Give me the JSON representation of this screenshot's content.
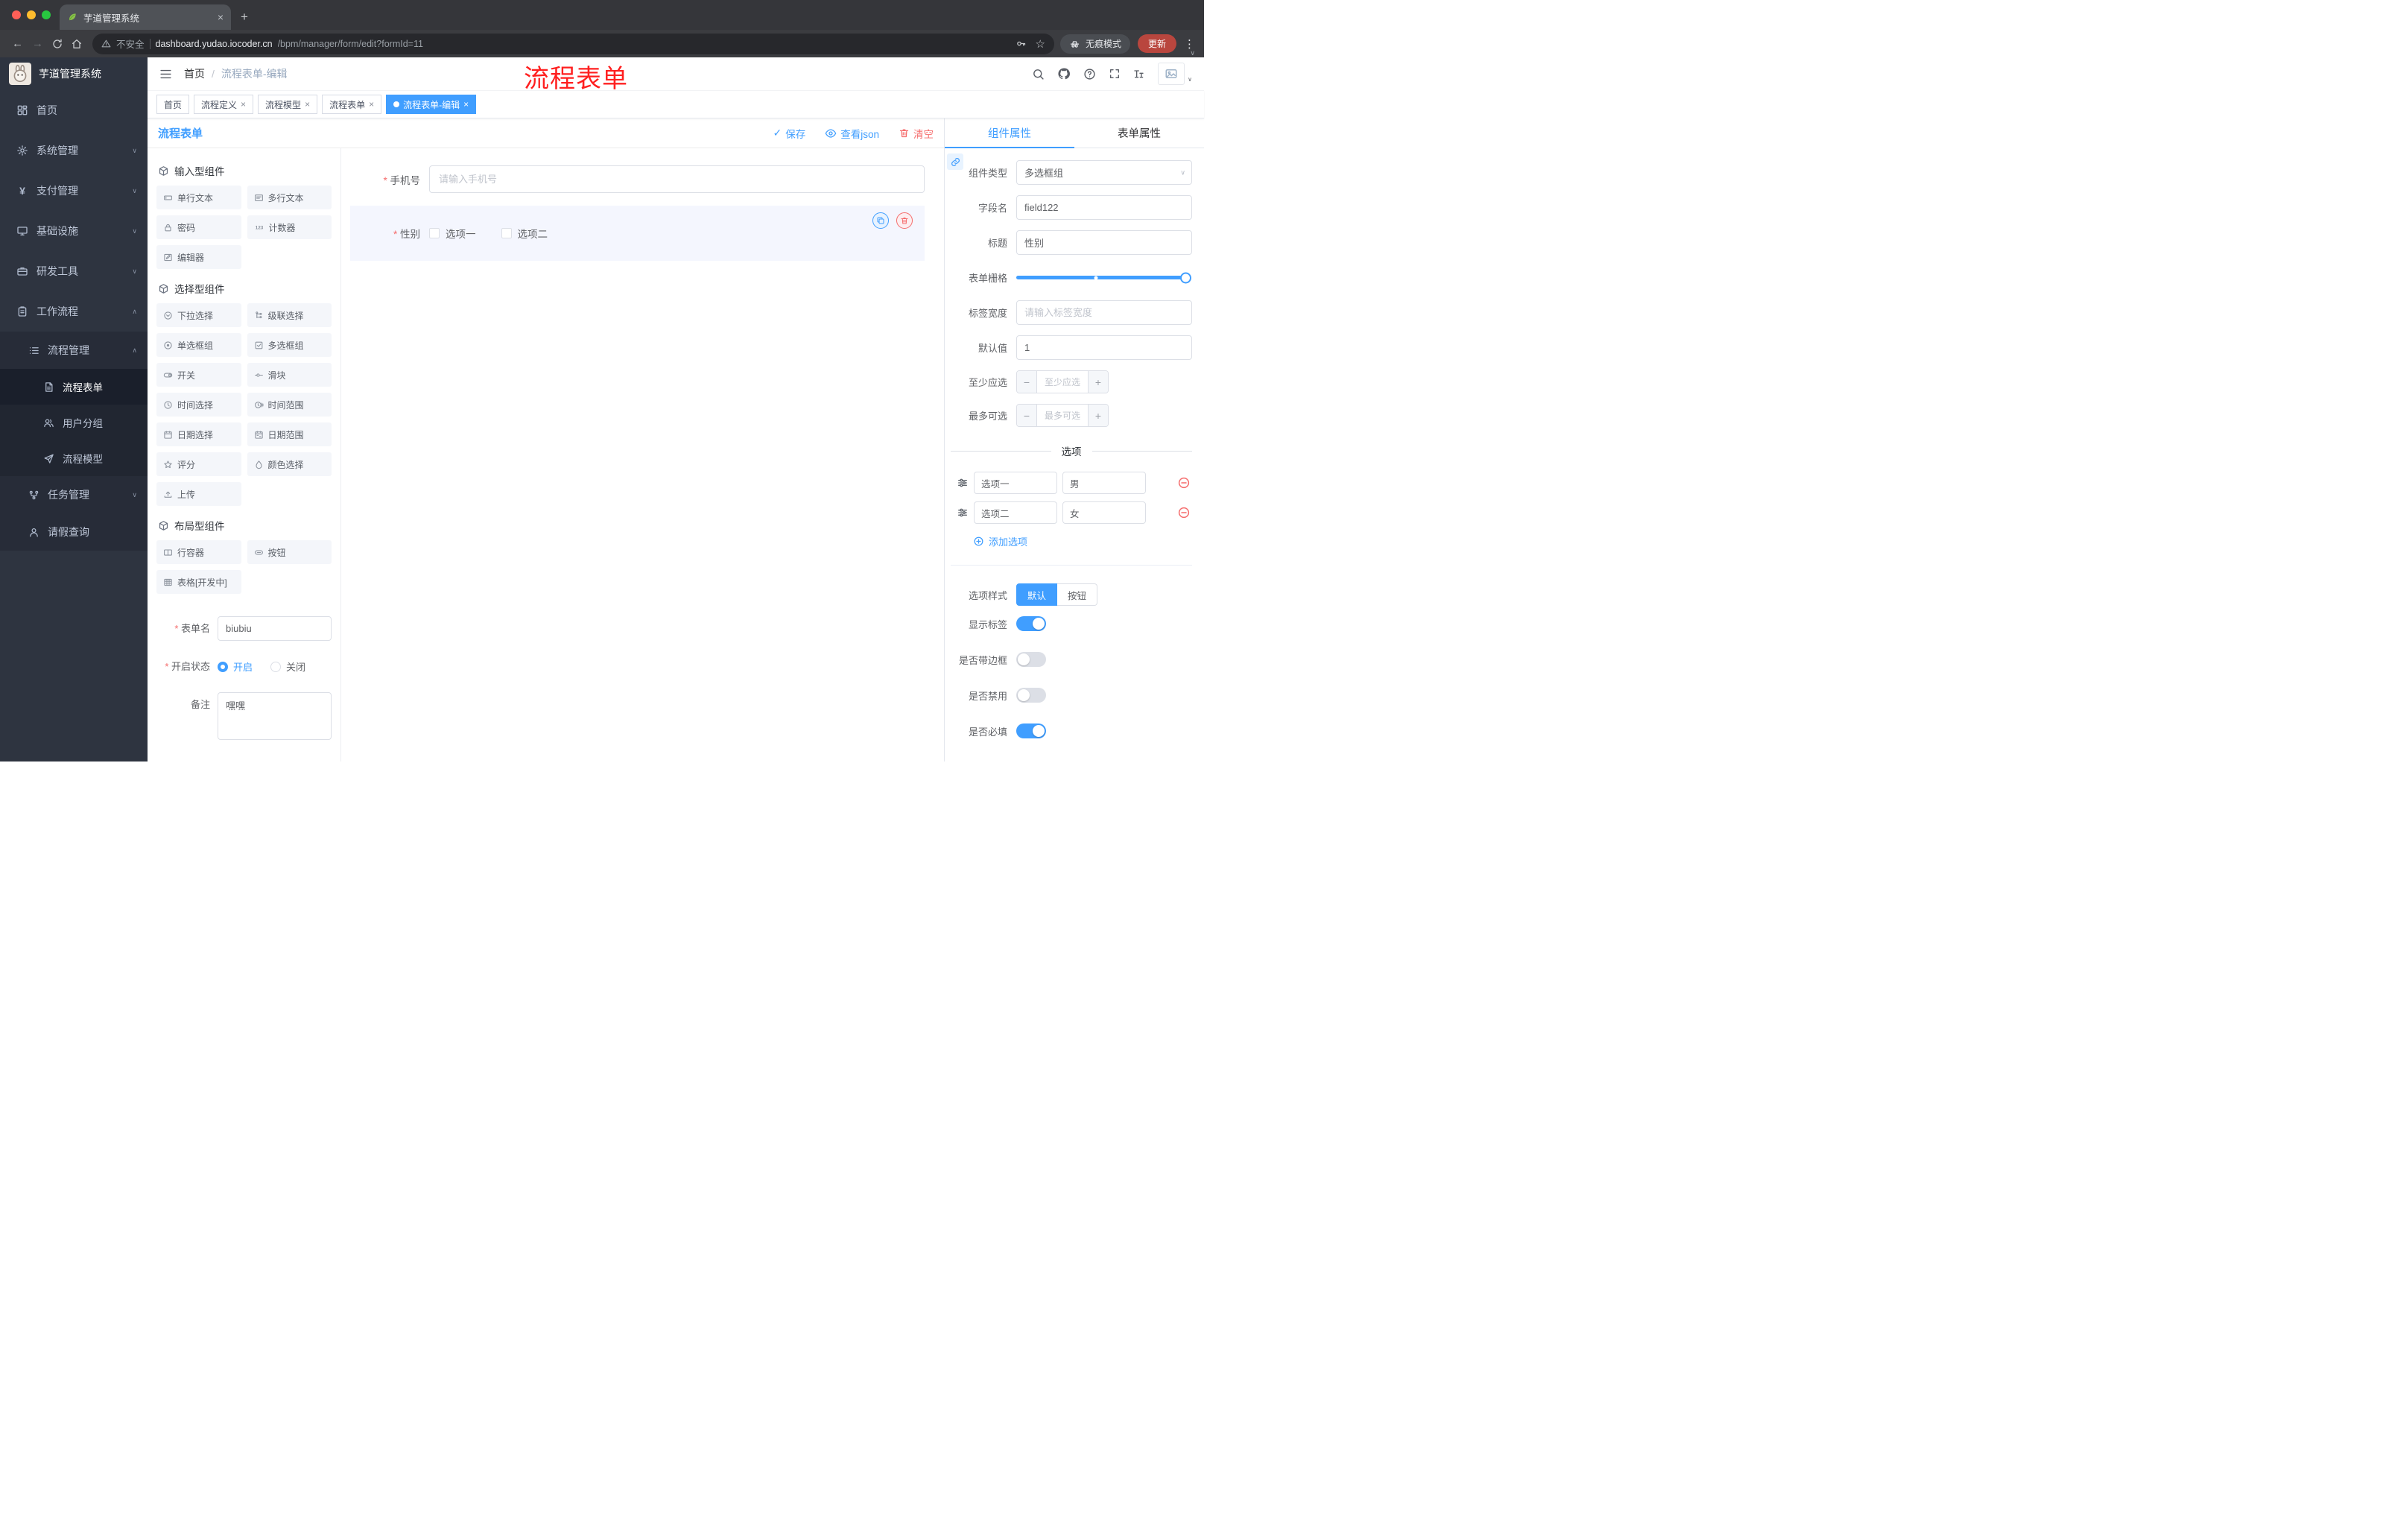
{
  "colors": {
    "accent": "#409eff",
    "danger": "#f56c6c",
    "annotation_red": "#ff1f1f",
    "active_tag_bg": "#409eff",
    "update_button_bg": "#b9463e",
    "sidebar_bg": "#2e3440"
  },
  "icons": {
    "tab_favicon": "leaf",
    "security": "warning-triangle",
    "bookmark": "star-outline",
    "passwords": "key",
    "incognito": "spy-glasses",
    "browser_menu": "three-dots-vertical",
    "save": "check",
    "view_json": "eye",
    "clear": "trash",
    "copy_component": "copy",
    "delete_component": "trash",
    "add_option": "plus-circle",
    "remove_option": "minus-circle",
    "option_drag": "sliders",
    "panel_corner": "chain-link"
  },
  "browser": {
    "tab_title": "芋道管理系统",
    "security_label": "不安全",
    "url_host": "dashboard.yudao.iocoder.cn",
    "url_path": "/bpm/manager/form/edit?formId=11",
    "incognito_label": "无痕模式",
    "update_label": "更新"
  },
  "header": {
    "breadcrumb_home": "首页",
    "breadcrumb_current": "流程表单-编辑",
    "annotation": "流程表单"
  },
  "sidebar": {
    "logo_title": "芋道管理系统",
    "menu": [
      {
        "label": "首页"
      },
      {
        "label": "系统管理"
      },
      {
        "label": "支付管理"
      },
      {
        "label": "基础设施"
      },
      {
        "label": "研发工具"
      },
      {
        "label": "工作流程"
      }
    ],
    "workflow": {
      "process_mgmt": "流程管理",
      "children": [
        "流程表单",
        "用户分组",
        "流程模型"
      ],
      "task_mgmt": "任务管理",
      "leave_query": "请假查询",
      "active": "流程表单"
    }
  },
  "tags": [
    {
      "label": "首页"
    },
    {
      "label": "流程定义"
    },
    {
      "label": "流程模型"
    },
    {
      "label": "流程表单"
    },
    {
      "label": "流程表单-编辑"
    }
  ],
  "designer": {
    "title": "流程表单",
    "save": "保存",
    "view_json": "查看json",
    "clear": "清空",
    "palette": {
      "groups": [
        {
          "title": "输入型组件",
          "items": [
            "单行文本",
            "多行文本",
            "密码",
            "计数器",
            "编辑器"
          ]
        },
        {
          "title": "选择型组件",
          "items": [
            "下拉选择",
            "级联选择",
            "单选框组",
            "多选框组",
            "开关",
            "滑块",
            "时间选择",
            "时间范围",
            "日期选择",
            "日期范围",
            "评分",
            "颜色选择",
            "上传"
          ]
        },
        {
          "title": "布局型组件",
          "items": [
            "行容器",
            "按钮",
            "表格[开发中]"
          ]
        }
      ]
    },
    "meta": {
      "form_name_label": "表单名",
      "form_name_value": "biubiu",
      "status_label": "开启状态",
      "status_on": "开启",
      "status_off": "关闭",
      "status_selected": "开启",
      "remark_label": "备注",
      "remark_value": "嘿嘿"
    },
    "canvas": {
      "phone_label": "手机号",
      "phone_placeholder": "请输入手机号",
      "gender_label": "性别",
      "gender_options": [
        "选项一",
        "选项二"
      ]
    }
  },
  "props": {
    "tab_component": "组件属性",
    "tab_form": "表单属性",
    "active_tab": "组件属性",
    "component_type_label": "组件类型",
    "component_type_value": "多选框组",
    "field_name_label": "字段名",
    "field_name_value": "field122",
    "title_label": "标题",
    "title_value": "性别",
    "grid_label": "表单栅格",
    "label_width_label": "标签宽度",
    "label_width_placeholder": "请输入标签宽度",
    "default_label": "默认值",
    "default_value": "1",
    "min_label": "至少应选",
    "min_placeholder": "至少应选",
    "max_label": "最多可选",
    "max_placeholder": "最多可选",
    "options_title": "选项",
    "options": [
      {
        "label": "选项一",
        "value": "男"
      },
      {
        "label": "选项二",
        "value": "女"
      }
    ],
    "add_option_label": "添加选项",
    "option_style_label": "选项样式",
    "option_style_default": "默认",
    "option_style_button": "按钮",
    "option_style_selected": "默认",
    "switches": [
      {
        "label": "显示标签",
        "on": true
      },
      {
        "label": "是否带边框",
        "on": false
      },
      {
        "label": "是否禁用",
        "on": false
      },
      {
        "label": "是否必填",
        "on": true
      }
    ]
  }
}
